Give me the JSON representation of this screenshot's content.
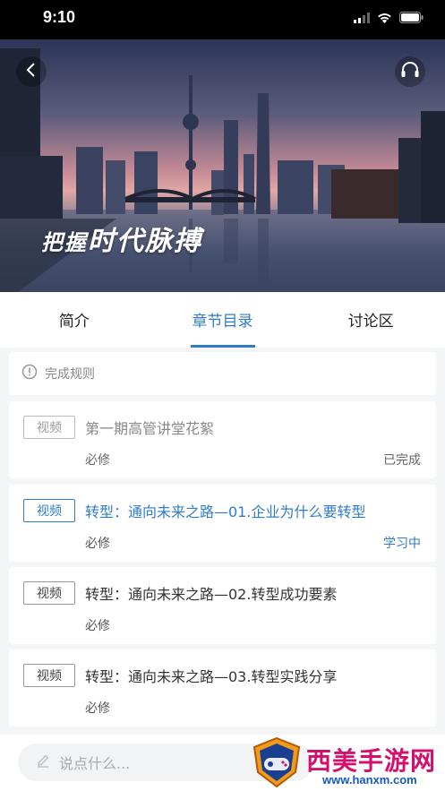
{
  "status_bar": {
    "time": "9:10"
  },
  "hero": {
    "slogan_small": "把握",
    "slogan_big": "时代脉搏"
  },
  "tabs": [
    {
      "label": "简介"
    },
    {
      "label": "章节目录"
    },
    {
      "label": "讨论区"
    }
  ],
  "rule": {
    "label": "完成规则"
  },
  "lessons": [
    {
      "type": "视频",
      "title": "第一期高管讲堂花絮",
      "requirement": "必修",
      "status": "已完成"
    },
    {
      "type": "视频",
      "title": "转型：通向未来之路—01.企业为什么要转型",
      "requirement": "必修",
      "status": "学习中"
    },
    {
      "type": "视频",
      "title": "转型：通向未来之路—02.转型成功要素",
      "requirement": "必修",
      "status": ""
    },
    {
      "type": "视频",
      "title": "转型：通向未来之路—03.转型实践分享",
      "requirement": "必修",
      "status": ""
    }
  ],
  "comment": {
    "placeholder": "说点什么..."
  },
  "watermark": {
    "name": "西美手游网",
    "url": "www.hanxm.com"
  },
  "colors": {
    "accent": "#2f7ccb",
    "watermark_pink": "#d4106f",
    "watermark_blue": "#1559c6"
  }
}
